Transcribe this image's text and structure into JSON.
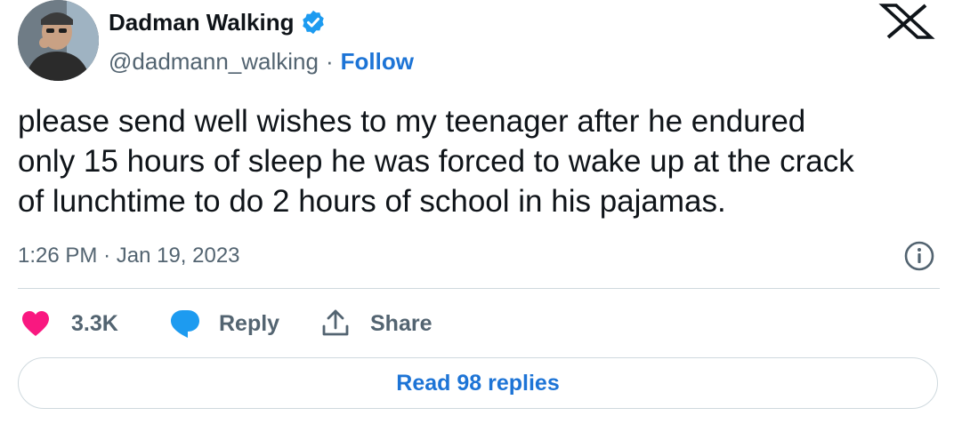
{
  "author": {
    "display_name": "Dadman Walking",
    "handle": "@dadmann_walking",
    "separator": "·",
    "follow_label": "Follow",
    "verified_color": "#1d9bf0"
  },
  "tweet": {
    "text": "please send well wishes to my teenager after he endured\nonly 15 hours of sleep he was forced to wake up at the crack\nof lunchtime to do 2 hours of school in his pajamas.",
    "time": "1:26 PM",
    "date_separator": "·",
    "date": "Jan 19, 2023"
  },
  "actions": {
    "likes": "3.3K",
    "reply_label": "Reply",
    "share_label": "Share",
    "like_color": "#f91880",
    "reply_color": "#1d9bf0"
  },
  "replies_button": {
    "label": "Read 98 replies"
  },
  "icons": {
    "verified": "verified-badge-icon",
    "brand": "x-logo-icon",
    "info": "info-icon",
    "like": "heart-icon",
    "reply": "speech-bubble-icon",
    "share": "share-upload-icon"
  }
}
